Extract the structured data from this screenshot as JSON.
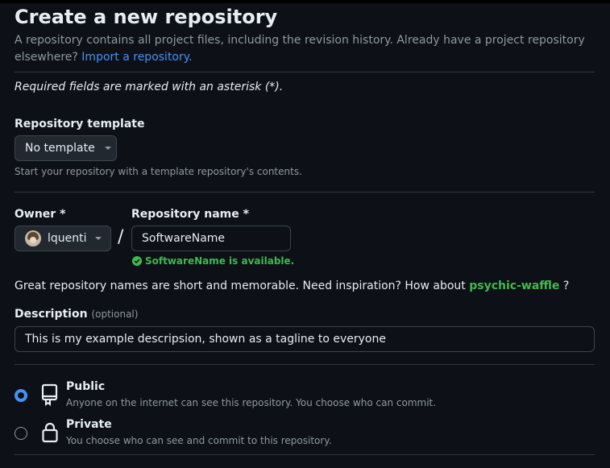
{
  "title": "Create a new repository",
  "intro": {
    "text": "A repository contains all project files, including the revision history. Already have a project repository elsewhere?",
    "import_link": "Import a repository."
  },
  "required_note": "Required fields are marked with an asterisk (*).",
  "template": {
    "label": "Repository template",
    "selected": "No template",
    "hint": "Start your repository with a template repository's contents."
  },
  "owner": {
    "label": "Owner *",
    "selected": "lquenti"
  },
  "separator": "/",
  "repo_name": {
    "label": "Repository name *",
    "value": "SoftwareName",
    "availability": "SoftwareName is available."
  },
  "inspiration": {
    "text": "Great repository names are short and memorable. Need inspiration? How about",
    "suggestion": "psychic-waffle",
    "suffix": "?"
  },
  "description": {
    "label": "Description",
    "optional": "(optional)",
    "value": "This is my example descripsion, shown as a tagline to everyone"
  },
  "visibility": {
    "public": {
      "title": "Public",
      "desc": "Anyone on the internet can see this repository. You choose who can commit.",
      "selected": true,
      "icon": "repo-icon"
    },
    "private": {
      "title": "Private",
      "desc": "You choose who can see and commit to this repository.",
      "selected": false,
      "icon": "lock-icon"
    }
  },
  "colors": {
    "background": "#0d1117",
    "link": "#4493f8",
    "success": "#3fb950",
    "muted": "#9198a1",
    "border": "#3d444d"
  }
}
